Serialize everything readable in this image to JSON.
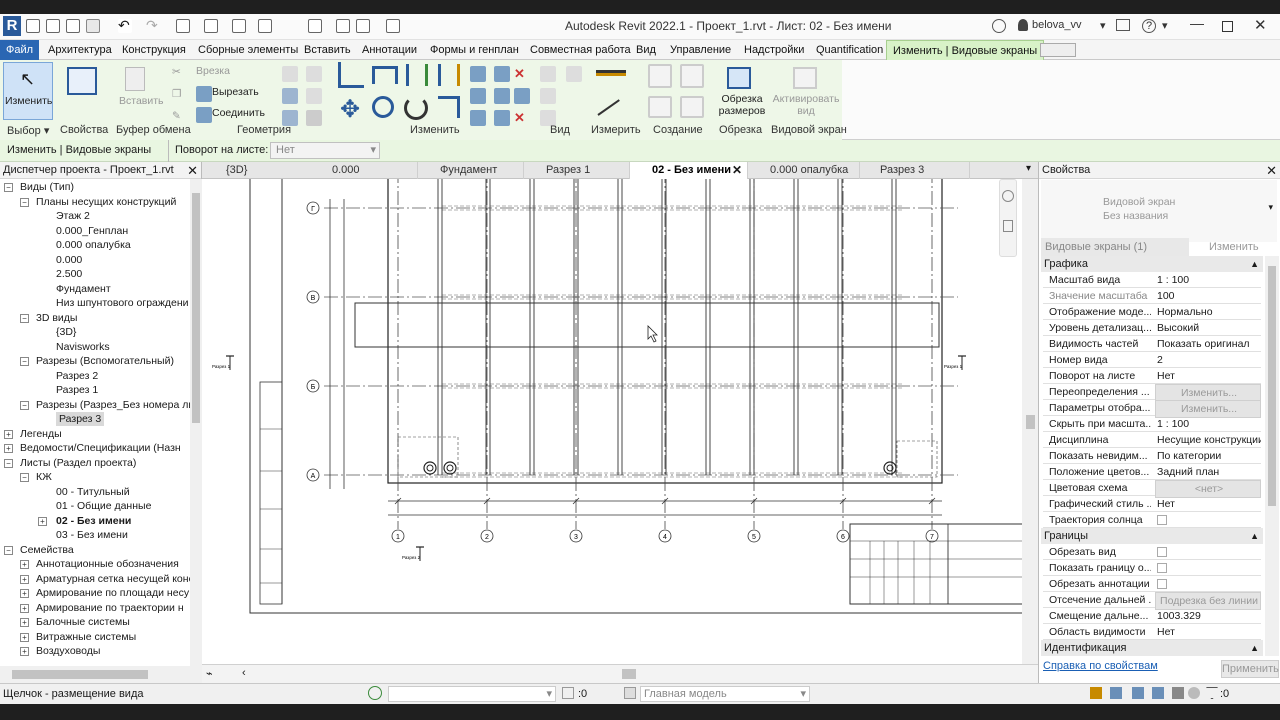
{
  "window": {
    "title": "Autodesk Revit 2022.1 - Проект_1.rvt - Лист: 02 - Без имени",
    "user": "belova_vv"
  },
  "ribbon_tabs": [
    "Файл",
    "Архитектура",
    "Конструкция",
    "Сборные элементы",
    "Вставить",
    "Аннотации",
    "Формы и генплан",
    "Совместная работа",
    "Вид",
    "Управление",
    "Надстройки",
    "Quantification",
    "Изменить | Видовые экраны"
  ],
  "ribbon": {
    "modify_label": "Изменить",
    "properties_label": "Свойства",
    "paste_label": "Вставить",
    "cut_label": "Врезка",
    "cut2_label": "Вырезать",
    "join_label": "Соединить",
    "crop_label": "Обрезка размеров",
    "activate_label": "Активировать вид",
    "panels": [
      "Выбор",
      "Свойства",
      "Буфер обмена",
      "Геометрия",
      "Изменить",
      "Вид",
      "Измерить",
      "Создание",
      "Обрезка",
      "Видовой экран"
    ]
  },
  "options_bar": {
    "context": "Изменить | Видовые экраны",
    "rotation_label": "Поворот на листе:",
    "rotation_value": "Нет"
  },
  "browser": {
    "title": "Диспетчер проекта - Проект_1.rvt",
    "items": [
      {
        "label": "Виды (Тип)",
        "level": 0,
        "exp": "−"
      },
      {
        "label": "Планы несущих конструкций",
        "level": 1,
        "exp": "−"
      },
      {
        "label": "Этаж 2",
        "level": 2
      },
      {
        "label": "0.000_Генплан",
        "level": 2
      },
      {
        "label": "0.000 опалубка",
        "level": 2
      },
      {
        "label": "0.000",
        "level": 2
      },
      {
        "label": "2.500",
        "level": 2
      },
      {
        "label": "Фундамент",
        "level": 2
      },
      {
        "label": "Низ шпунтового ограждени",
        "level": 2
      },
      {
        "label": "3D виды",
        "level": 1,
        "exp": "−"
      },
      {
        "label": "{3D}",
        "level": 2
      },
      {
        "label": "Navisworks",
        "level": 2
      },
      {
        "label": "Разрезы (Вспомогательный)",
        "level": 1,
        "exp": "−"
      },
      {
        "label": "Разрез 2",
        "level": 2
      },
      {
        "label": "Разрез 1",
        "level": 2
      },
      {
        "label": "Разрезы (Разрез_Без номера ли",
        "level": 1,
        "exp": "−"
      },
      {
        "label": "Разрез 3",
        "level": 2,
        "sel": true
      },
      {
        "label": "Легенды",
        "level": 0,
        "exp": "+"
      },
      {
        "label": "Ведомости/Спецификации (Назн",
        "level": 0,
        "exp": "+"
      },
      {
        "label": "Листы (Раздел проекта)",
        "level": 0,
        "exp": "−"
      },
      {
        "label": "КЖ",
        "level": 1,
        "exp": "−"
      },
      {
        "label": "00 - Титульный",
        "level": 2
      },
      {
        "label": "01 - Общие данные",
        "level": 2
      },
      {
        "label": "02 - Без имени",
        "level": 2,
        "bold": true,
        "exp": "+"
      },
      {
        "label": "03 - Без имени",
        "level": 2
      },
      {
        "label": "Семейства",
        "level": 0,
        "exp": "−"
      },
      {
        "label": "Аннотационные обозначения",
        "level": 1,
        "exp": "+"
      },
      {
        "label": "Арматурная сетка несущей конс",
        "level": 1,
        "exp": "+"
      },
      {
        "label": "Армирование по площади несу",
        "level": 1,
        "exp": "+"
      },
      {
        "label": "Армирование по траектории н",
        "level": 1,
        "exp": "+"
      },
      {
        "label": "Балочные системы",
        "level": 1,
        "exp": "+"
      },
      {
        "label": "Витражные системы",
        "level": 1,
        "exp": "+"
      },
      {
        "label": "Воздуховоды",
        "level": 1,
        "exp": "+"
      }
    ]
  },
  "view_tabs": [
    {
      "label": "{3D}"
    },
    {
      "label": "0.000"
    },
    {
      "label": "Фундамент"
    },
    {
      "label": "Разрез 1"
    },
    {
      "label": "02 - Без имени",
      "active": true
    },
    {
      "label": "0.000 опалубка"
    },
    {
      "label": "Разрез 3"
    }
  ],
  "drawing": {
    "grid_rows": [
      "Г",
      "В",
      "Б",
      "А"
    ],
    "grid_cols": [
      "1",
      "2",
      "3",
      "4",
      "5",
      "6",
      "7"
    ],
    "section_labels": [
      "Разрез 1",
      "Разрез 1",
      "Разрез 2"
    ]
  },
  "properties": {
    "title": "Свойства",
    "type_name_1": "Видовой экран",
    "type_name_2": "Без названия",
    "selector": "Видовые экраны (1)",
    "edit_type": "Изменить тип",
    "sections": {
      "graphics": "Графика",
      "bounds": "Границы",
      "identity": "Идентификация"
    },
    "graphics_rows": [
      {
        "k": "Масштаб вида",
        "v": "1 : 100"
      },
      {
        "k": "Значение масштаба",
        "v": "100",
        "gray": true
      },
      {
        "k": "Отображение моде...",
        "v": "Нормально"
      },
      {
        "k": "Уровень детализац...",
        "v": "Высокий"
      },
      {
        "k": "Видимость частей",
        "v": "Показать оригинал"
      },
      {
        "k": "Номер вида",
        "v": "2"
      },
      {
        "k": "Поворот на листе",
        "v": "Нет"
      },
      {
        "k": "Переопределения ...",
        "v": "Изменить...",
        "btn": true
      },
      {
        "k": "Параметры отобра...",
        "v": "Изменить...",
        "btn": true
      },
      {
        "k": "Скрыть при масшта...",
        "v": "1 : 100"
      },
      {
        "k": "Дисциплина",
        "v": "Несущие конструкции"
      },
      {
        "k": "Показать невидим...",
        "v": "По категории"
      },
      {
        "k": "Положение цветов...",
        "v": "Задний план"
      },
      {
        "k": "Цветовая схема",
        "v": "<нет>",
        "btn": true
      },
      {
        "k": "Графический стиль ...",
        "v": "Нет"
      },
      {
        "k": "Траектория солнца",
        "v": ""
      }
    ],
    "bounds_rows": [
      {
        "k": "Обрезать вид",
        "v": ""
      },
      {
        "k": "Показать границу о...",
        "v": ""
      },
      {
        "k": "Обрезать аннотации",
        "v": ""
      },
      {
        "k": "Отсечение дальней ...",
        "v": "Подрезка без линии",
        "btn": true
      },
      {
        "k": "Смещение дальне...",
        "v": "1003.329"
      },
      {
        "k": "Область видимости",
        "v": "Нет"
      }
    ],
    "help_link": "Справка по свойствам",
    "apply": "Применить"
  },
  "status": {
    "message": "Щелчок - размещение вида",
    "coord": ":0",
    "model": "Главная модель",
    "filter": ":0"
  }
}
